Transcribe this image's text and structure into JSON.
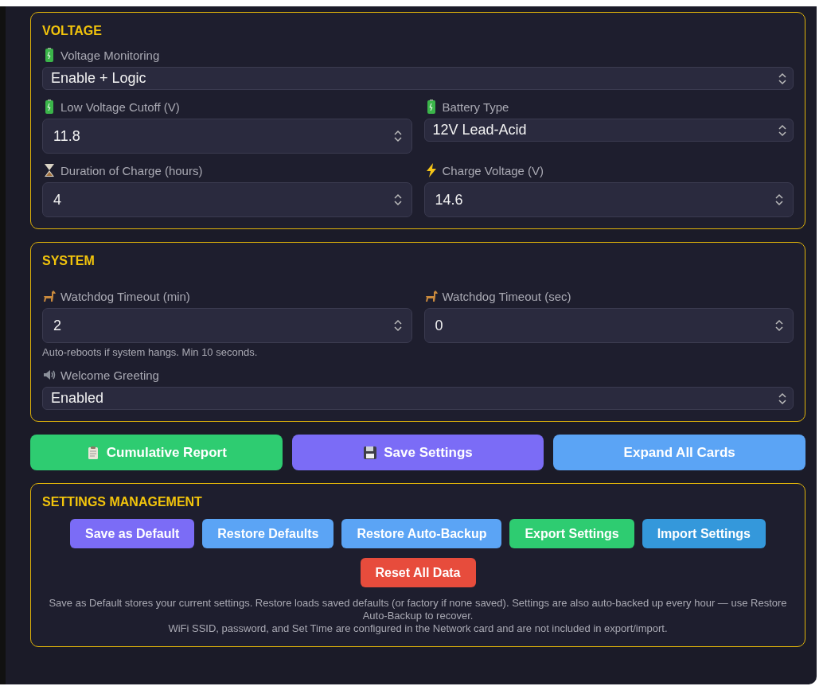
{
  "sections": [
    {
      "title": "VOLTAGE",
      "rows": [
        [
          {
            "label": "Voltage Monitoring",
            "kind": "select",
            "value": "Enable + Logic"
          }
        ],
        [
          {
            "label": "Low Voltage Cutoff (V)",
            "kind": "number",
            "value": "11.8"
          },
          {
            "label": "Battery Type",
            "kind": "select",
            "value": "12V Lead-Acid"
          }
        ],
        [
          {
            "label": "Duration of Charge (hours)",
            "kind": "number",
            "value": "4"
          },
          {
            "label": "Charge Voltage (V)",
            "kind": "number",
            "value": "14.6"
          }
        ]
      ]
    },
    {
      "title": "SYSTEM",
      "rows": [
        [
          {
            "label": "Watchdog Timeout (min)",
            "kind": "number",
            "value": "2",
            "hint": "Auto-reboots if system hangs. Min 10 seconds."
          },
          {
            "label": "Watchdog Timeout (sec)",
            "kind": "number",
            "value": "0"
          }
        ],
        [
          {
            "label": "Welcome Greeting",
            "kind": "select",
            "value": "Enabled"
          }
        ]
      ]
    }
  ],
  "actions": [
    {
      "label": "Cumulative Report",
      "color": "#2ecc71"
    },
    {
      "label": "Save Settings",
      "color": "#7b6cf6"
    },
    {
      "label": "Expand All Cards",
      "color": "#5ba4f5"
    }
  ],
  "management": {
    "title": "SETTINGS MANAGEMENT",
    "buttons": [
      {
        "label": "Save as Default",
        "color": "#7b6cf6"
      },
      {
        "label": "Restore Defaults",
        "color": "#5ba4f5"
      },
      {
        "label": "Restore Auto-Backup",
        "color": "#5ba4f5"
      },
      {
        "label": "Export Settings",
        "color": "#2ecc71"
      },
      {
        "label": "Import Settings",
        "color": "#3498db"
      },
      {
        "label": "Reset All Data",
        "color": "#e74c3c"
      }
    ],
    "notes": [
      "Save as Default stores your current settings. Restore loads saved defaults (or factory if none saved). Settings are also auto-backed up every hour — use Restore Auto-Backup to recover.",
      "WiFi SSID, password, and Set Time are configured in the Network card and are not included in export/import."
    ]
  }
}
